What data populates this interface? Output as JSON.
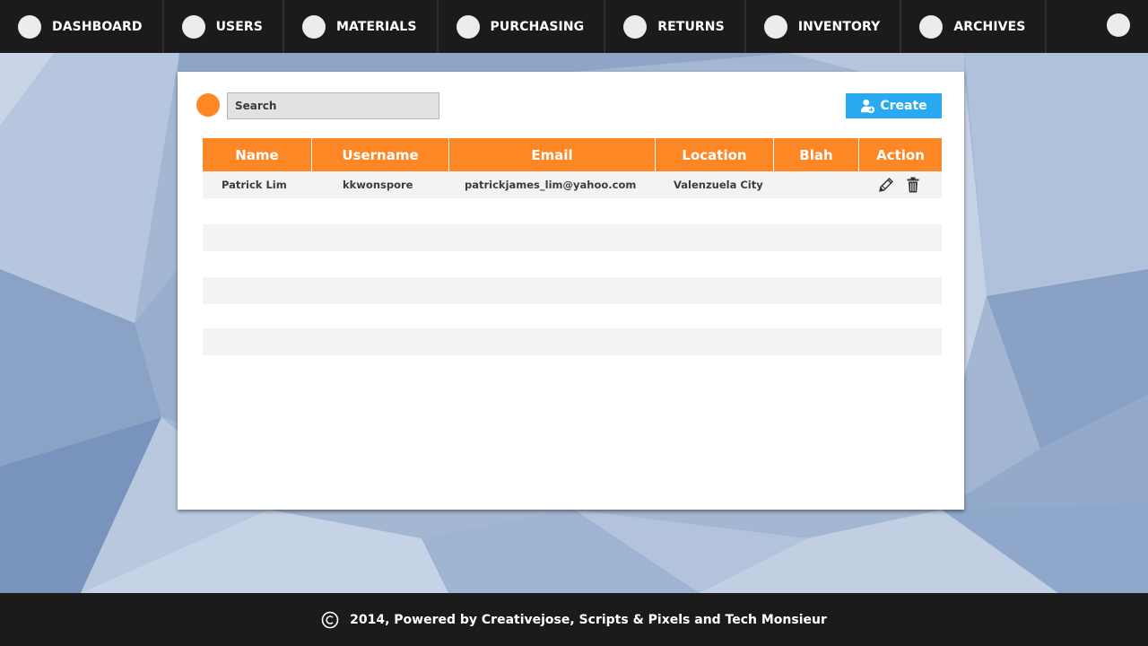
{
  "nav": {
    "items": [
      {
        "label": "DASHBOARD"
      },
      {
        "label": "USERS"
      },
      {
        "label": "MATERIALS"
      },
      {
        "label": "PURCHASING"
      },
      {
        "label": "RETURNS"
      },
      {
        "label": "INVENTORY"
      },
      {
        "label": "ARCHIVES"
      }
    ]
  },
  "toolbar": {
    "search_placeholder": "Search",
    "search_value": "",
    "create_label": "Create"
  },
  "table": {
    "headers": [
      "Name",
      "Username",
      "Email",
      "Location",
      "Blah",
      "Action"
    ],
    "rows": [
      {
        "name": "Patrick Lim",
        "username": "kkwonspore",
        "email": "patrickjames_lim@yahoo.com",
        "location": "Valenzuela City",
        "blah": ""
      }
    ]
  },
  "footer": {
    "text": "2014, Powered by Creativejose, Scripts & Pixels and Tech Monsieur"
  },
  "colors": {
    "nav_bg": "#1b1b1b",
    "accent_orange": "#fd8725",
    "create_blue": "#29a9f0",
    "row_shade": "#f3f3f3",
    "background": "#9db2cf"
  },
  "icons": {
    "nav_item": "circle-icon",
    "profile": "circle-icon",
    "search": "orange-circle-icon",
    "create": "user-add-icon",
    "edit": "pencil-icon",
    "delete": "trash-icon",
    "footer": "copyright-icon"
  }
}
